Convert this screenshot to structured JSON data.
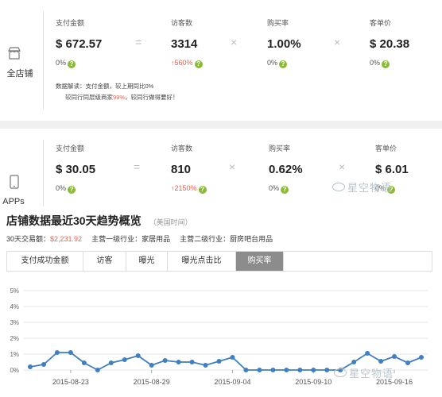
{
  "store": {
    "label": "全店铺",
    "icon": "storefront-icon",
    "metrics": [
      {
        "label": "支付金额",
        "value": "$ 672.57",
        "change": "0%",
        "up": false
      },
      {
        "label": "访客数",
        "value": "3314",
        "change": "↑560%",
        "up": true
      },
      {
        "label": "购买率",
        "value": "1.00%",
        "change": "0%",
        "up": false
      },
      {
        "label": "客单价",
        "value": "$ 20.38",
        "change": "0%",
        "up": false
      }
    ],
    "operators": [
      "=",
      "×",
      "×"
    ],
    "note_line1": "数据解读：支付金额，较上期同比0%",
    "note_line2_a": "较同行同层级商家",
    "note_line2_b": "99%",
    "note_line2_c": "，较同行做得要好！"
  },
  "app": {
    "label": "APPs",
    "icon": "mobile-phone-icon",
    "metrics": [
      {
        "label": "支付金额",
        "value": "$ 30.05",
        "change": "0%",
        "up": false
      },
      {
        "label": "访客数",
        "value": "810",
        "change": "↑2150%",
        "up": true
      },
      {
        "label": "购买率",
        "value": "0.62%",
        "change": "0%",
        "up": false
      },
      {
        "label": "客单价",
        "value": "$ 6.01",
        "change": "0%",
        "up": false
      }
    ],
    "operators": [
      "=",
      "×",
      "×"
    ]
  },
  "help_mark": "?",
  "watermark": "星空物语",
  "trend": {
    "title": "店铺数据最近30天趋势概览",
    "timezone": "（美国时间）",
    "sub_label": "30天交易额：",
    "sub_amount": "$2,231.92",
    "industry1": "主营一级行业：家居用品",
    "industry2": "主营二级行业：厨房吧台用品",
    "tabs": [
      "支付成功金额",
      "访客",
      "曝光",
      "曝光点击比",
      "购买率"
    ],
    "active_tab": 4
  },
  "chart_data": {
    "type": "line",
    "title": "",
    "xlabel": "",
    "ylabel": "",
    "ylim": [
      0,
      5
    ],
    "yticks": [
      "0%",
      "1%",
      "2%",
      "3%",
      "4%",
      "5%"
    ],
    "grid": true,
    "color": "#3f7fc2",
    "x_ticks": [
      "2015-08-23",
      "2015-08-29",
      "2015-09-04",
      "2015-09-10",
      "2015-09-16"
    ],
    "x": [
      "2015-08-20",
      "2015-08-21",
      "2015-08-22",
      "2015-08-23",
      "2015-08-24",
      "2015-08-25",
      "2015-08-26",
      "2015-08-27",
      "2015-08-28",
      "2015-08-29",
      "2015-08-30",
      "2015-08-31",
      "2015-09-01",
      "2015-09-02",
      "2015-09-03",
      "2015-09-04",
      "2015-09-05",
      "2015-09-06",
      "2015-09-07",
      "2015-09-08",
      "2015-09-09",
      "2015-09-10",
      "2015-09-11",
      "2015-09-12",
      "2015-09-13",
      "2015-09-14",
      "2015-09-15",
      "2015-09-16",
      "2015-09-17",
      "2015-09-18"
    ],
    "values": [
      0.2,
      0.35,
      1.1,
      1.1,
      0.45,
      0.0,
      0.45,
      0.65,
      0.9,
      0.3,
      0.6,
      0.5,
      0.5,
      0.3,
      0.55,
      0.8,
      0.0,
      0.0,
      0.0,
      0.0,
      0.0,
      0.0,
      0.0,
      0.0,
      0.5,
      1.05,
      0.55,
      0.85,
      0.45,
      0.8
    ]
  }
}
